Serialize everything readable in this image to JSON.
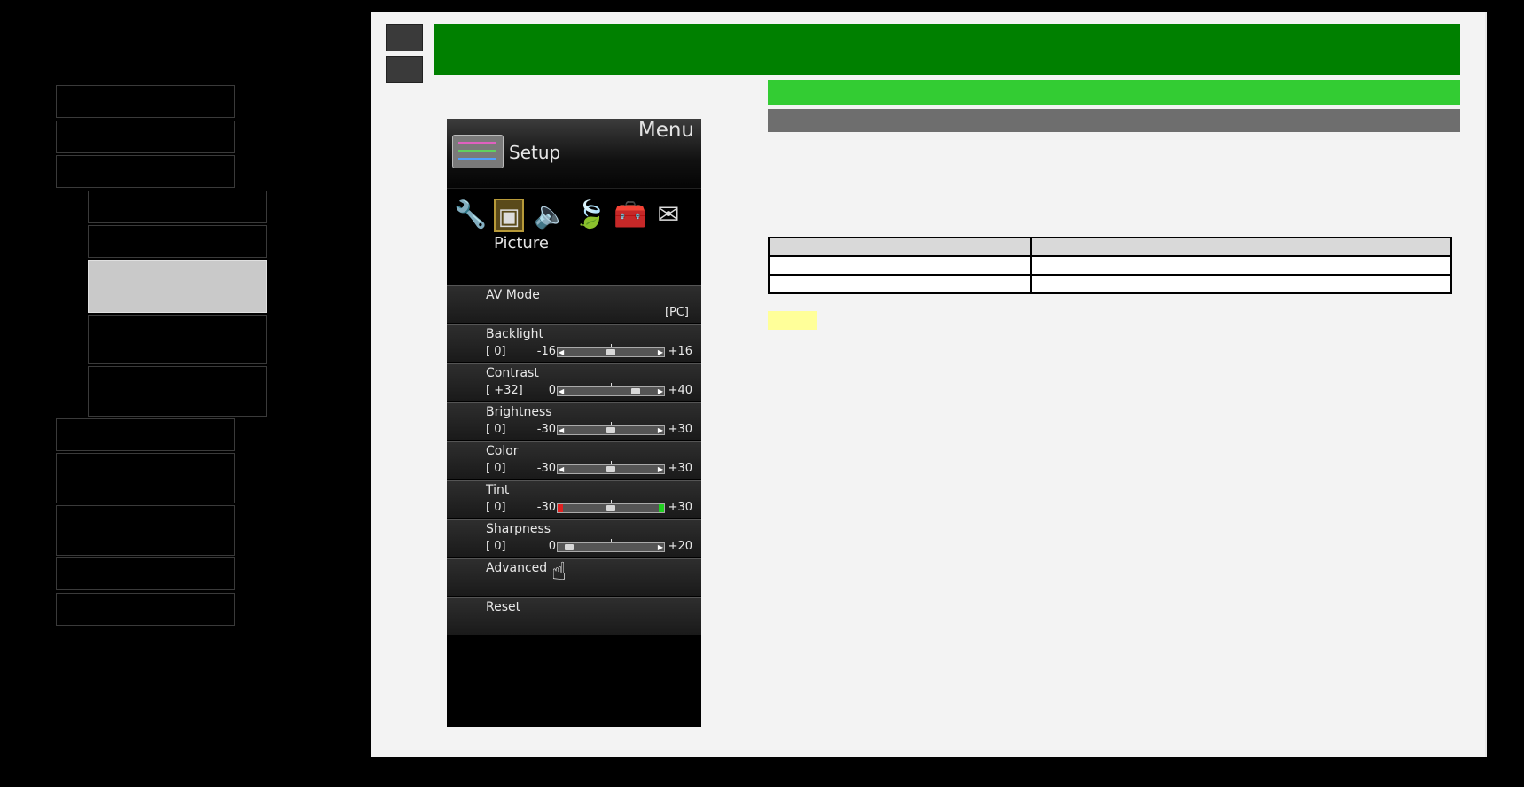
{
  "tv_menu": {
    "menu_title": "Menu",
    "setup_label": "Setup",
    "tab_icons": [
      "wrench-icon",
      "picture-icon",
      "speaker-icon",
      "leaf-icon",
      "toolbox-icon",
      "mail-icon"
    ],
    "picture_label": "Picture",
    "rows": {
      "av_mode": {
        "label": "AV Mode",
        "value": "[PC]"
      },
      "backlight": {
        "label": "Backlight",
        "value": "[    0]",
        "min": "-16",
        "max": "+16",
        "level": 0.5
      },
      "contrast": {
        "label": "Contrast",
        "value": "[ +32]",
        "min": "0",
        "max": "+40",
        "level": 0.8
      },
      "brightness": {
        "label": "Brightness",
        "value": "[    0]",
        "min": "-30",
        "max": "+30",
        "level": 0.5
      },
      "color": {
        "label": "Color",
        "value": "[    0]",
        "min": "-30",
        "max": "+30",
        "level": 0.5
      },
      "tint": {
        "label": "Tint",
        "value": "[    0]",
        "min": "-30",
        "max": "+30",
        "level": 0.5
      },
      "sharpness": {
        "label": "Sharpness",
        "value": "[    0]",
        "min": "0",
        "max": "+20",
        "level": 0.0
      },
      "advanced": {
        "label": "Advanced"
      },
      "reset": {
        "label": "Reset"
      }
    }
  },
  "colors": {
    "title_bar": "#008000",
    "sub_green": "#33cc33",
    "sub_gray": "#6e6e6e",
    "note_tag": "#ffff99",
    "sidebar_active": "#c9c9c9"
  }
}
